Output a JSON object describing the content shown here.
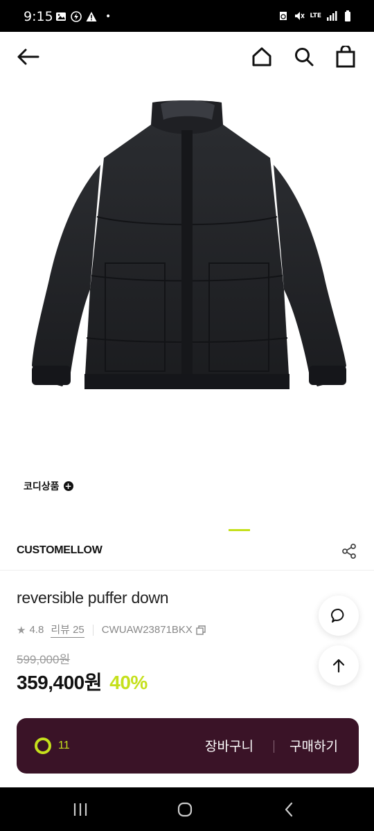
{
  "status_bar": {
    "time": "9:15",
    "dot": "•",
    "network": "LTE"
  },
  "header": {
    "icons": [
      "back-arrow-icon",
      "home-icon",
      "search-icon",
      "shopping-bag-icon"
    ]
  },
  "product": {
    "image": "black-puffer-jacket",
    "codi_label": "코디상품",
    "brand": "CUSTOMELLOW",
    "title": "reversible puffer down",
    "rating": "4.8",
    "review_label": "리뷰 25",
    "product_code": "CWUAW23871BKX",
    "original_price": "599,000원",
    "sale_price": "359,400원",
    "discount": "40%"
  },
  "buy_bar": {
    "like_count": "11",
    "cart_label": "장바구니",
    "purchase_label": "구매하기"
  },
  "colors": {
    "accent": "#c5e01c",
    "buy_bar_bg": "#3a1327"
  }
}
